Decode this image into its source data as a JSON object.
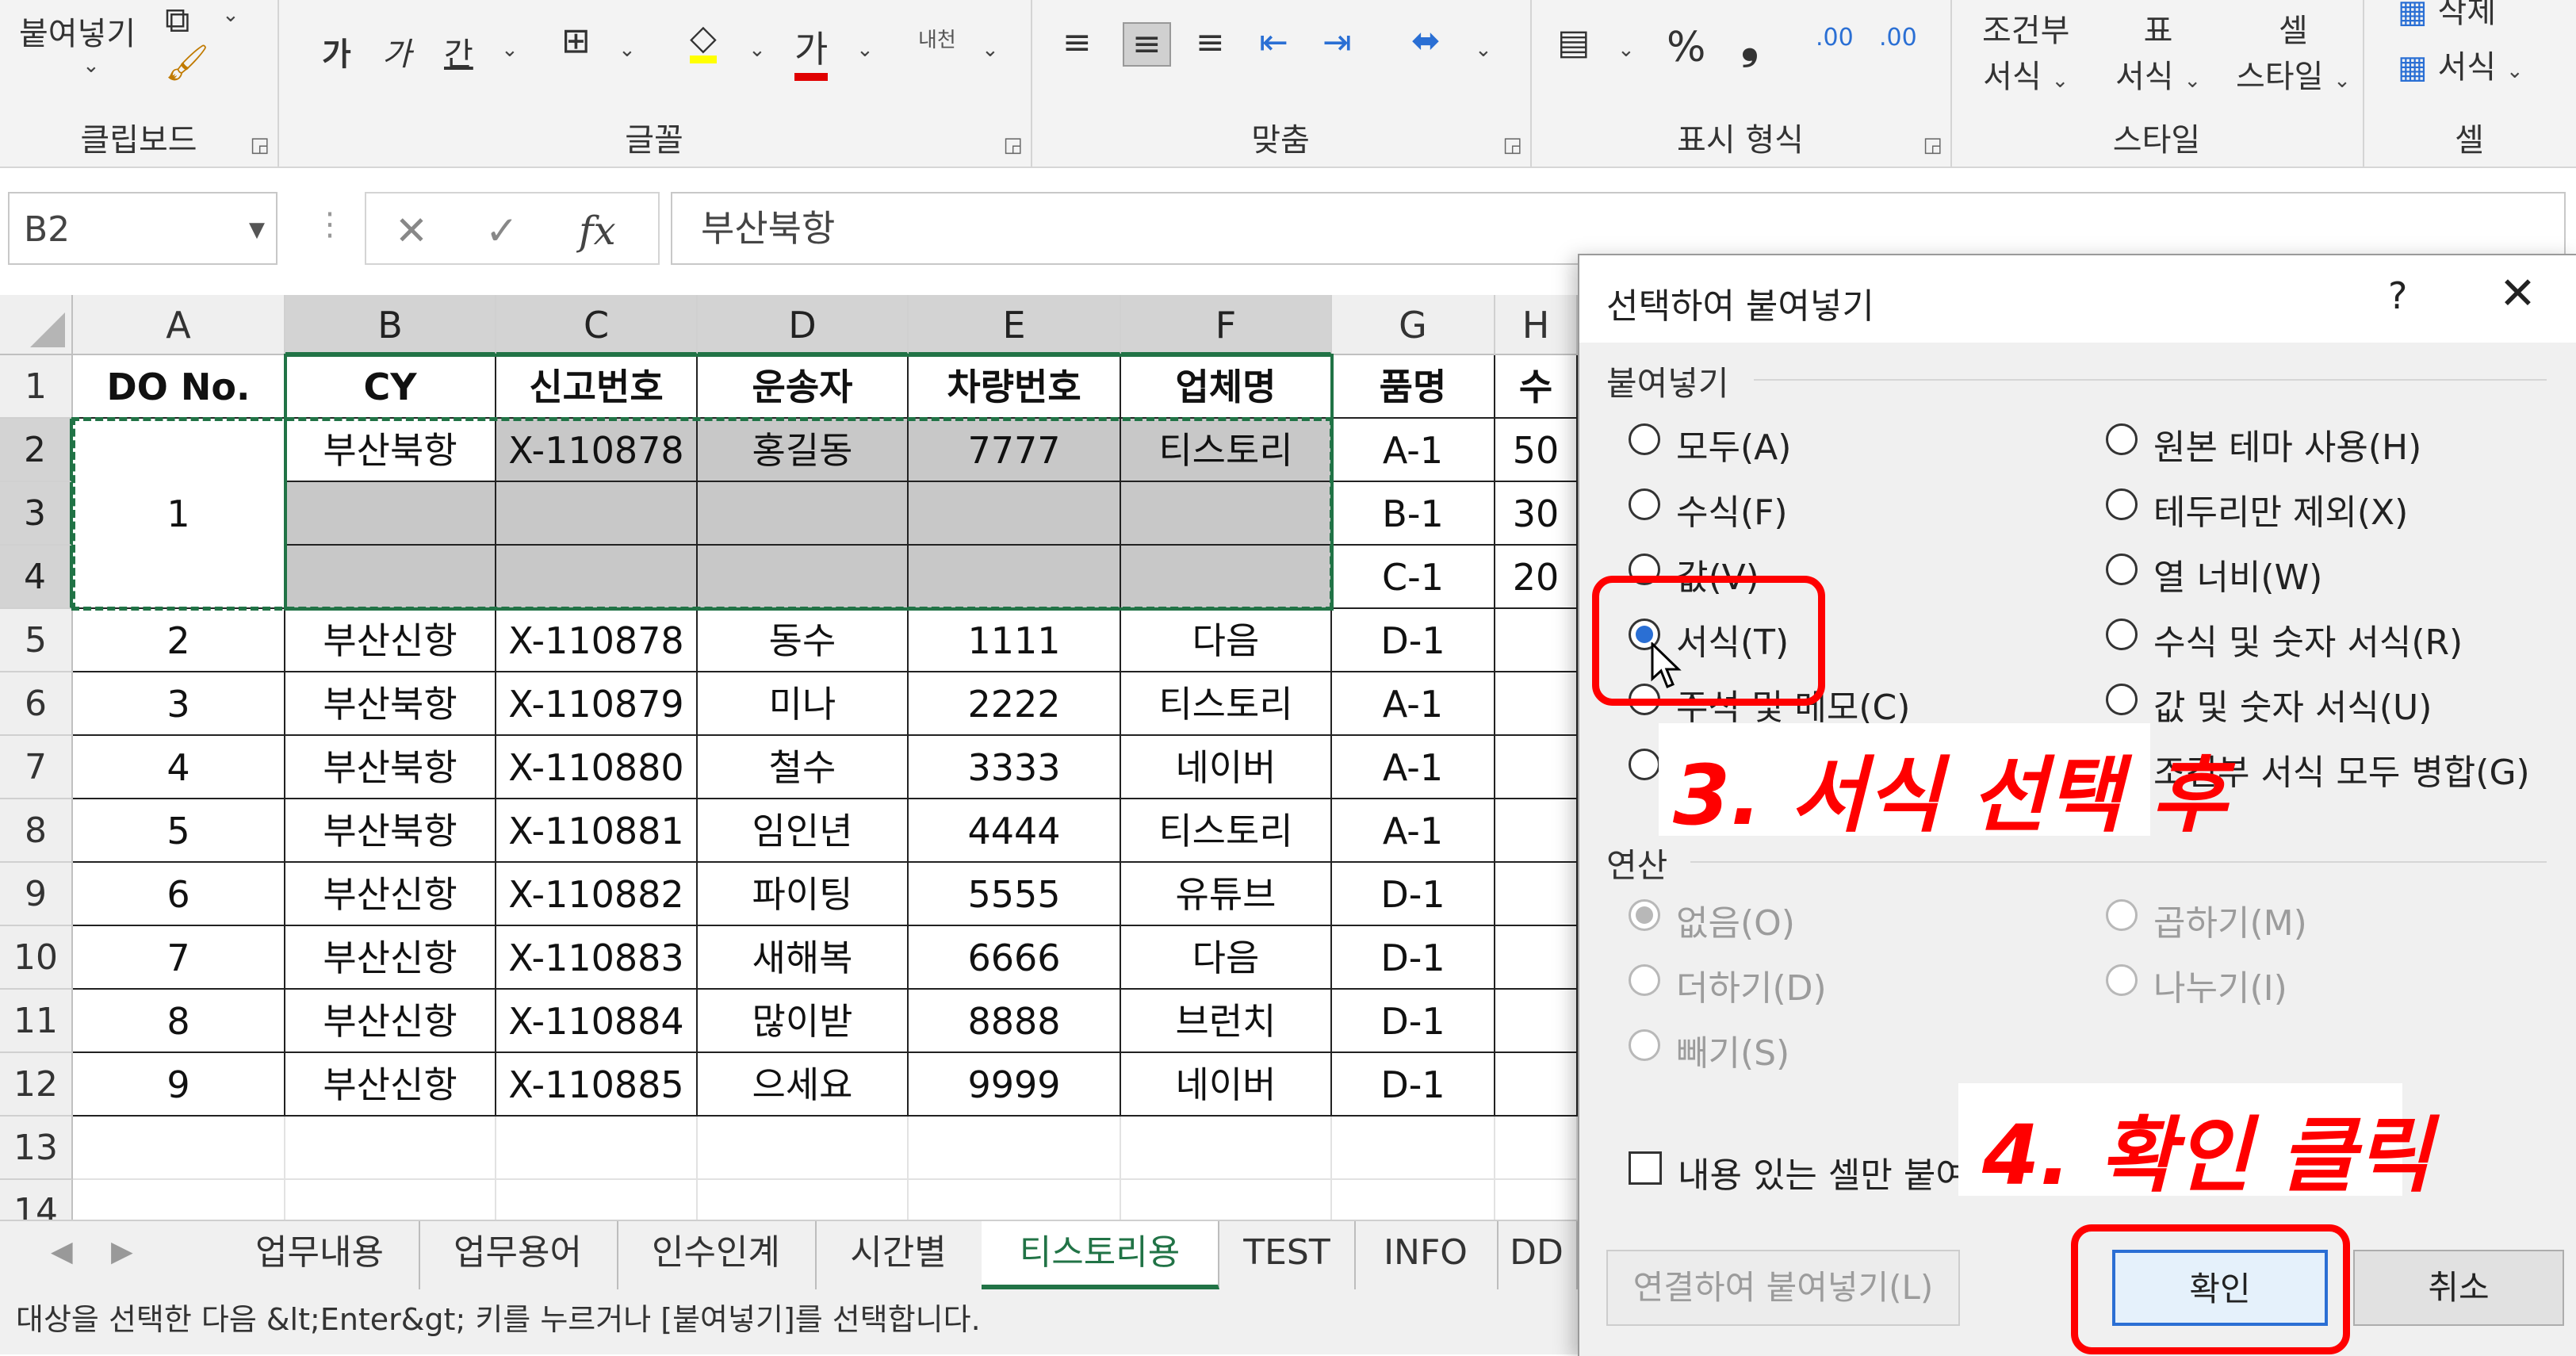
{
  "ribbon": {
    "paste_label": "붙여넣기",
    "groups": {
      "clipboard": "클립보드",
      "font": "글꼴",
      "alignment": "맞춤",
      "number": "표시 형식",
      "styles": "스타일",
      "cells": "셀"
    },
    "font_buttons": [
      "가",
      "가",
      "간"
    ],
    "wrap_label": "내천",
    "styles_buttons": {
      "conditional_l1": "조건부",
      "conditional_l2": "서식",
      "table_l1": "표",
      "table_l2": "서식",
      "cell_l1": "셀",
      "cell_l2": "스타일"
    },
    "cells_buttons": {
      "delete": "삭제",
      "format": "서식"
    },
    "percent": "%",
    "comma": "❟",
    "inc_decimal": ".00",
    "dec_decimal": ".00"
  },
  "formula_bar": {
    "name_box": "B2",
    "formula": "부산북항",
    "fx": "fx"
  },
  "grid": {
    "columns": [
      "A",
      "B",
      "C",
      "D",
      "E",
      "F",
      "G",
      "H"
    ],
    "rows": [
      "1",
      "2",
      "3",
      "4",
      "5",
      "6",
      "7",
      "8",
      "9",
      "10",
      "11",
      "12",
      "13",
      "14"
    ],
    "header_row": [
      "DO No.",
      "CY",
      "신고번호",
      "운송자",
      "차량번호",
      "업체명",
      "품명",
      "수"
    ],
    "merged_a": "1",
    "b2": "부산북항",
    "row2": [
      "X-110878",
      "홍길동",
      "7777",
      "티스토리",
      "A-1",
      "50"
    ],
    "row3": [
      "B-1",
      "30"
    ],
    "row4": [
      "C-1",
      "20"
    ],
    "data": [
      [
        "2",
        "부산신항",
        "X-110878",
        "동수",
        "1111",
        "다음",
        "D-1"
      ],
      [
        "3",
        "부산북항",
        "X-110879",
        "미나",
        "2222",
        "티스토리",
        "A-1"
      ],
      [
        "4",
        "부산북항",
        "X-110880",
        "철수",
        "3333",
        "네이버",
        "A-1"
      ],
      [
        "5",
        "부산북항",
        "X-110881",
        "임인년",
        "4444",
        "티스토리",
        "A-1"
      ],
      [
        "6",
        "부산신항",
        "X-110882",
        "파이팅",
        "5555",
        "유튜브",
        "D-1"
      ],
      [
        "7",
        "부산신항",
        "X-110883",
        "새해복",
        "6666",
        "다음",
        "D-1"
      ],
      [
        "8",
        "부산신항",
        "X-110884",
        "많이받",
        "8888",
        "브런치",
        "D-1"
      ],
      [
        "9",
        "부산신항",
        "X-110885",
        "으세요",
        "9999",
        "네이버",
        "D-1"
      ]
    ]
  },
  "sheet_tabs": [
    "업무내용",
    "업무용어",
    "인수인계",
    "시간별",
    "티스토리용",
    "TEST",
    "INFO",
    "DD"
  ],
  "active_tab": "티스토리용",
  "status_text": "대상을 선택한 다음 &lt;Enter&gt; 키를 누르거나 [붙여넣기]를 선택합니다.",
  "dialog": {
    "title": "선택하여 붙여넣기",
    "help": "?",
    "close": "✕",
    "paste_section": "붙여넣기",
    "paste_options_left": [
      "모두(A)",
      "수식(F)",
      "값(V)",
      "서식(T)",
      "주석 및 메모(C)",
      ""
    ],
    "paste_options_right": [
      "원본 테마 사용(H)",
      "테두리만 제외(X)",
      "열 너비(W)",
      "수식 및 숫자 서식(R)",
      "값 및 숫자 서식(U)",
      "조건부 서식 모두 병합(G)"
    ],
    "selected_option": "서식(T)",
    "operation_section": "연산",
    "operation_left": [
      "없음(O)",
      "더하기(D)",
      "빼기(S)"
    ],
    "operation_right": [
      "곱하기(M)",
      "나누기(I)"
    ],
    "skip_blanks": "내용 있는 셀만 붙여",
    "paste_link": "연결하여 붙여넣기(L)",
    "ok": "확인",
    "cancel": "취소"
  },
  "annotations": {
    "step3": "3. 서식 선택 후",
    "step4": "4. 확인 클릭"
  },
  "colors": {
    "excel_green": "#217346",
    "annotation_red": "#ff0000",
    "radio_blue": "#2a6fd4"
  }
}
